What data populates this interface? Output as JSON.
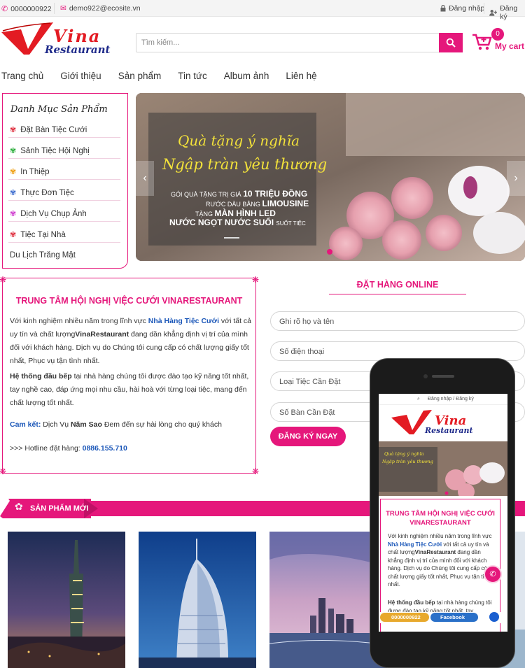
{
  "topbar": {
    "phone": "0000000922",
    "email": "demo922@ecosite.vn",
    "login": "Đăng nhập",
    "register": "Đăng ký"
  },
  "logo": {
    "brand": "Vina",
    "sub": "Restaurant"
  },
  "search": {
    "placeholder": "Tìm kiếm..."
  },
  "cart": {
    "count": "0",
    "label": "My cart"
  },
  "nav": [
    "Trang chủ",
    "Giới thiệu",
    "Sản phẩm",
    "Tin tức",
    "Album ảnh",
    "Liên hệ"
  ],
  "categories": {
    "title": "Danh Mục Sản Phẩm",
    "items": [
      "Đặt Bàn Tiệc Cưới",
      "Sảnh Tiệc Hội Nghị",
      "In Thiệp",
      "Thực Đơn Tiệc",
      "Dịch Vụ Chụp Ảnh",
      "Tiệc Tại Nhà",
      "Du Lịch Trăng Mật"
    ]
  },
  "banner": {
    "line1": "Quà tặng ý nghĩa",
    "line2": "Ngập tràn yêu thương",
    "t1a": "GÓI QUÀ TẶNG TRỊ GIÁ",
    "t1b": "10 TRIỆU ĐỒNG",
    "t2a": "RƯỚC DÂU BẰNG",
    "t2b": "LIMOUSINE",
    "t3a": "TẶNG",
    "t3b": "MÀN HÌNH LED",
    "t4a": "NƯỚC NGỌT NƯỚC SUỐI",
    "t4b": "SUỐT TIỆC"
  },
  "intro": {
    "title": "TRUNG TÂM HỘI NGHỊ VIỆC CƯỚI VINARESTAURANT",
    "p1a": "Với kinh nghiệm nhiều năm trong lĩnh vực ",
    "p1b": "Nhà Hàng Tiệc Cưới",
    "p1c": " với tất cả uy tín và chất lượng",
    "p1d": "VinaRestaurant",
    "p1e": " đang dần khẳng định vị trí của mình đối với khách hàng. Dịch vụ do Chúng tôi cung cấp có chất lượng giấy tốt nhất, Phục vụ tận tình nhất.",
    "p2a": "Hệ thống đầu bếp",
    "p2b": " tại nhà hàng chúng tôi được đào tạo kỹ năng tốt nhất, tay nghề cao, đáp ứng mọi nhu cầu, hài hoà với từng loại tiệc, mang đến chất lượng tốt nhất.",
    "p3a": "Cam kết:",
    "p3b": " Dịch Vụ ",
    "p3c": "Năm Sao",
    "p3d": " Đem đến sự hài lòng cho quý khách",
    "p4a": ">>> Hotline đặt hàng: ",
    "p4b": "0886.155.710"
  },
  "order": {
    "title": "ĐẶT HÀNG ONLINE",
    "fields": [
      "Ghi rõ họ và tên",
      "Số điện thoại",
      "Loại Tiệc Cần Đặt",
      "Số Bàn Cần Đặt"
    ],
    "submit": "ĐĂNG KÝ NGAY"
  },
  "products": {
    "title": "SẢN PHẨM MỚI"
  },
  "mobile": {
    "login": "Đăng nhập",
    "sep": "/",
    "register": "Đăng ký",
    "title": "TRUNG TÂM HỘI NGHỊ VIỆC CƯỚI VINARESTAURANT",
    "p1a": "Với kinh nghiệm nhiều năm trong lĩnh vực ",
    "p1b": "Nhà Hàng Tiệc Cưới",
    "p1c": " với tất cả uy tín và chất lượng",
    "p1d": "VinaRestaurant",
    "p1e": " đang dần khẳng định vị trí của mình đối với khách hàng. Dịch vụ do Chúng tôi cung cấp có chất lượng giấy tốt nhất, Phục vụ tận tình nhất.",
    "p2a": "Hệ thống đầu bếp",
    "p2b": " tại nhà hàng chúng tôi được đào tạo kỹ năng tốt nhất, tay",
    "phone": "0000000922",
    "facebook": "Facebook"
  },
  "colors": {
    "accent": "#e5177b",
    "link": "#1a56b8"
  }
}
